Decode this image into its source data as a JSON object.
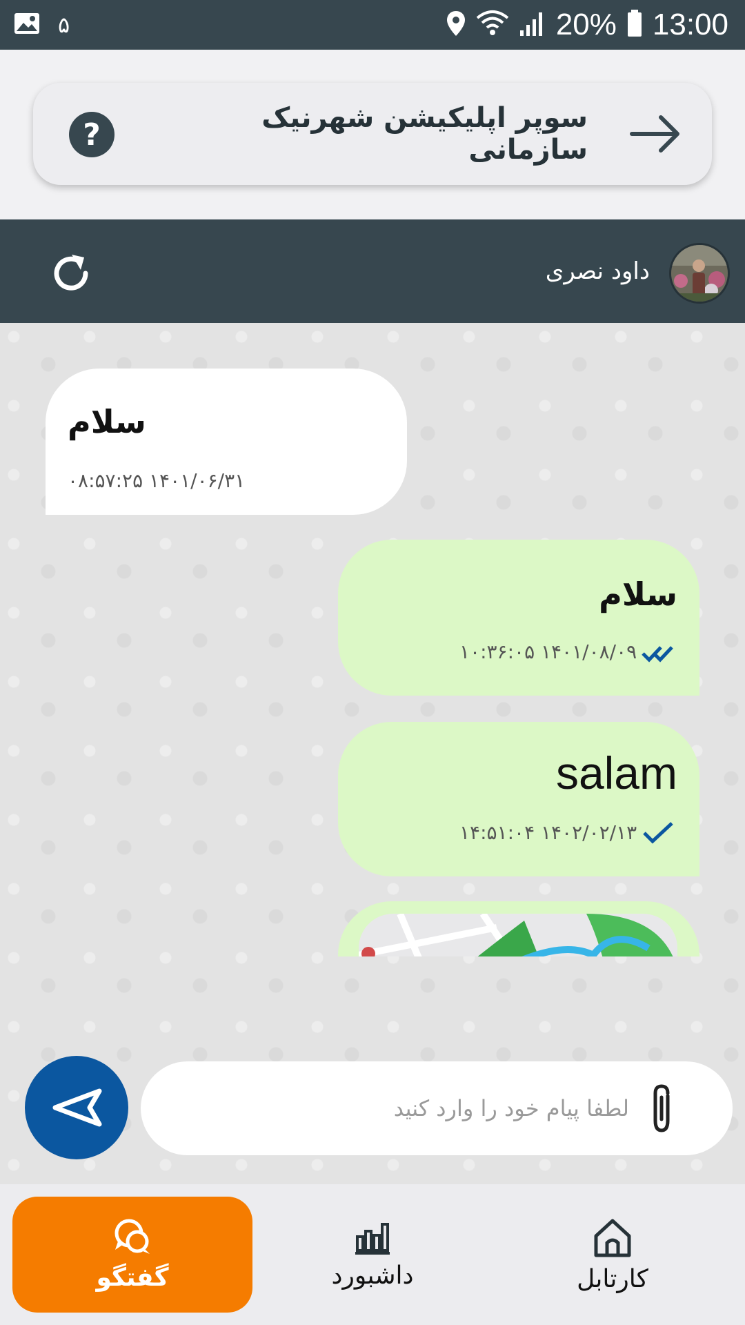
{
  "status_bar": {
    "notification_count": "۵",
    "battery": "20%",
    "time": "13:00",
    "icons": [
      "image-icon",
      "location-icon",
      "wifi-icon",
      "signal-icon",
      "battery-icon"
    ]
  },
  "header": {
    "title": "سوپر اپلیکیشن شهرنیک سازمانی",
    "help_symbol": "?"
  },
  "chat_header": {
    "contact_name": "داود نصری"
  },
  "messages": [
    {
      "direction": "in",
      "text": "سلام",
      "timestamp": "۱۴۰۱/۰۶/۳۱ ۰۸:۵۷:۲۵",
      "status": "none"
    },
    {
      "direction": "out",
      "text": "سلام",
      "timestamp": "۱۴۰۱/۰۸/۰۹ ۱۰:۳۶:۰۵",
      "status": "read"
    },
    {
      "direction": "out",
      "text": "salam",
      "timestamp": "۱۴۰۲/۰۲/۱۳ ۱۴:۵۱:۰۴",
      "status": "sent"
    },
    {
      "direction": "out",
      "type": "location-map",
      "text": ""
    }
  ],
  "composer": {
    "placeholder": "لطفا پیام خود را وارد کنید",
    "value": ""
  },
  "bottom_nav": {
    "items": [
      {
        "label": "گفتگو",
        "icon": "chat-icon",
        "active": true
      },
      {
        "label": "داشبورد",
        "icon": "bar-chart-icon",
        "active": false
      },
      {
        "label": "کارتابل",
        "icon": "home-icon",
        "active": false
      }
    ]
  },
  "colors": {
    "status_bar": "#37474f",
    "chat_header": "#37474f",
    "outgoing_bubble": "#dcf8c6",
    "incoming_bubble": "#ffffff",
    "send_button": "#0b57a0",
    "active_nav": "#f57c00",
    "tick": "#0b57a0"
  }
}
